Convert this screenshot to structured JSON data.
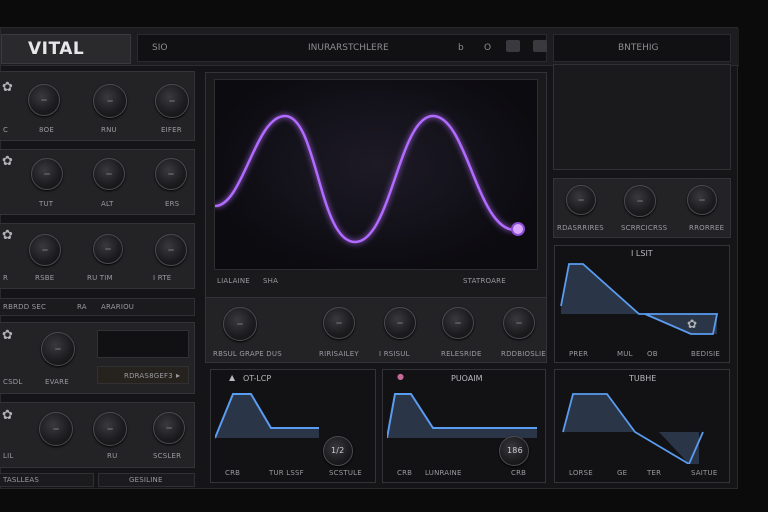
{
  "header": {
    "logo": "VITAL",
    "patch_bank": "SIO",
    "preset_name": "INURARSTCHLERE",
    "btn_a": "b",
    "btn_b": "O",
    "right_title": "BNTEHIG"
  },
  "left_column": {
    "row1": {
      "labels": [
        "C",
        "8OE",
        "RNU",
        "EIFER"
      ]
    },
    "row2": {
      "labels": [
        "",
        "TUT",
        "ALT",
        "ERS"
      ]
    },
    "row3": {
      "labels": [
        "R",
        "RSBE",
        "RU TIM",
        "I RTE"
      ]
    },
    "row_strip": {
      "labels": [
        "RBRDD SEC",
        "RA",
        "ARARIOU"
      ]
    },
    "row4": {
      "labels": [
        "CSDL",
        "EVARE",
        "RDRAS8GEF3"
      ],
      "display_value": ""
    },
    "row5": {
      "labels": [
        "LIL",
        "RU",
        "SCSLER"
      ]
    },
    "bottom": {
      "labels": [
        "TASLLEAS",
        "GESILINE"
      ]
    }
  },
  "oscillator": {
    "footer_left": "LIALAINE",
    "footer_mid": "SHA",
    "footer_right": "STATROARE",
    "wave_color": "#b26bff"
  },
  "osc_knobs": {
    "labels": [
      "RBSUL GRAPE DUS",
      "RIRISAILEY",
      "I RSISUL",
      "RELESRIDE",
      "RDDBIOSLIE"
    ]
  },
  "envelopes": [
    {
      "title": "OT-LCP",
      "labels": [
        "CRB",
        "TUR LSSF",
        "SCSTULE"
      ],
      "value": "1/2"
    },
    {
      "title": "PUOAIM",
      "labels": [
        "CRB",
        "LUNRAINE",
        "CRB"
      ],
      "value": "186"
    },
    {
      "title": "TUBHE",
      "labels": [
        "LORSE",
        "GE",
        "TER",
        "SAITUE"
      ]
    }
  ],
  "right_panel": {
    "knob_labels": [
      "RDASRRIRES",
      "SCRRCICRSS",
      "RRORREE"
    ],
    "env_top_title": "I LSIT",
    "env_top_labels": [
      "PRER",
      "MUL",
      "OB",
      "BEDISIE"
    ],
    "env_color": "#5a9cf0"
  }
}
